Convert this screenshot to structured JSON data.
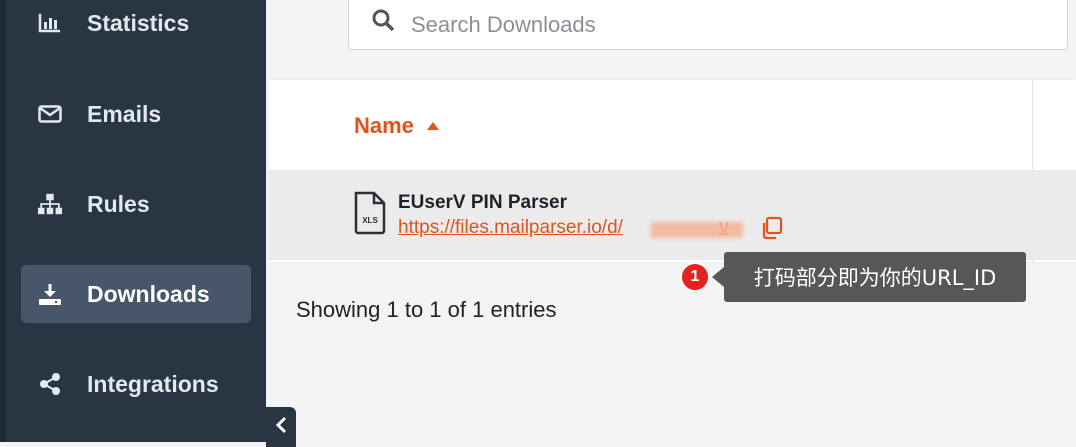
{
  "sidebar": {
    "items": [
      {
        "label": "Statistics",
        "icon": "bar-chart-icon"
      },
      {
        "label": "Emails",
        "icon": "envelope-icon"
      },
      {
        "label": "Rules",
        "icon": "sitemap-icon"
      },
      {
        "label": "Downloads",
        "icon": "download-icon",
        "active": true
      },
      {
        "label": "Integrations",
        "icon": "share-icon"
      }
    ]
  },
  "search": {
    "placeholder": "Search Downloads"
  },
  "table": {
    "columns": [
      {
        "label": "Name",
        "sort": "ascending"
      }
    ],
    "rows": [
      {
        "name": "EUserV PIN Parser",
        "link": "https://files.mailparser.io/d/",
        "link_suffix": "v",
        "file_type": "XLS"
      }
    ]
  },
  "footer": {
    "showing": "Showing 1 to 1 of 1 entries"
  },
  "annotation": {
    "badge": "1",
    "text": "打码部分即为你的URL_ID"
  },
  "colors": {
    "accent": "#e0531e",
    "sidebar": "#283543",
    "active_item": "#48566a",
    "badge": "#e5221f"
  }
}
